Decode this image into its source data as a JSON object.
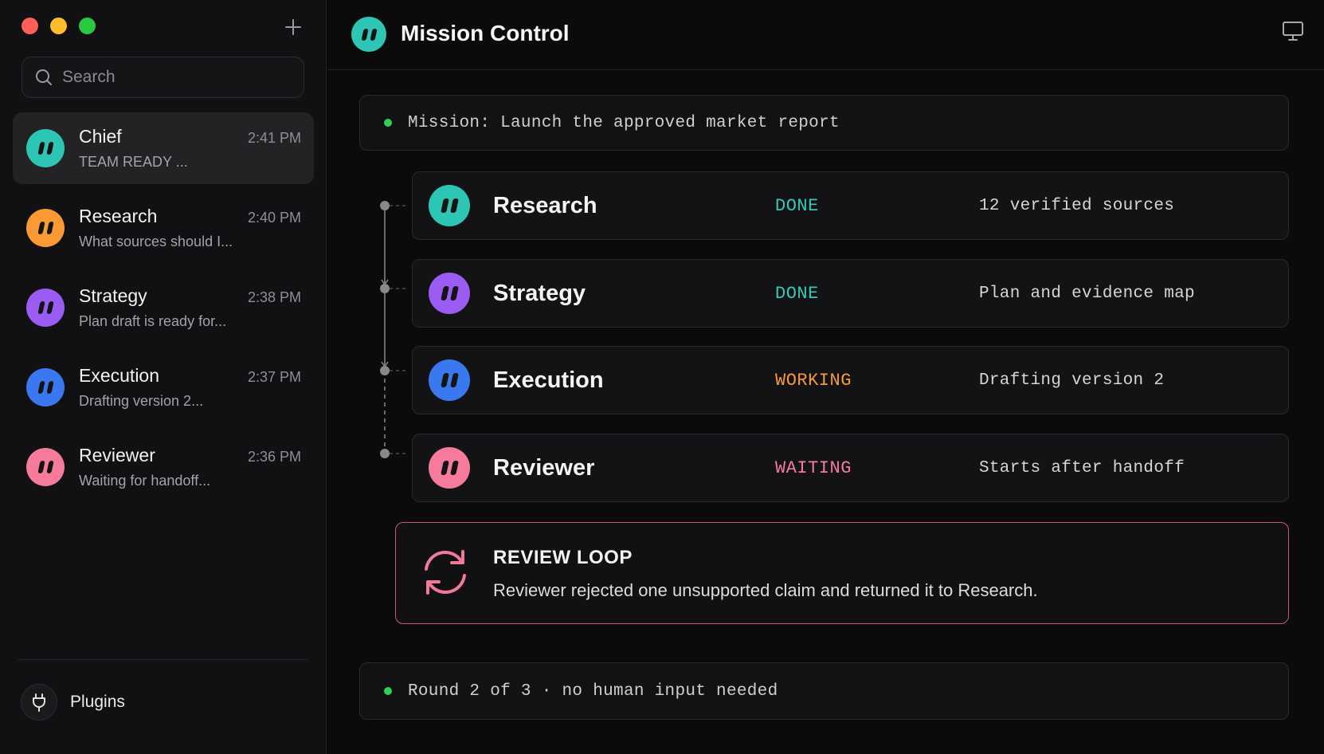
{
  "sidebar": {
    "search": {
      "placeholder": "Search"
    },
    "chats": [
      {
        "name": "Chief",
        "time": "2:41 PM",
        "preview": "TEAM READY ...",
        "color": "#2dc6b4",
        "active": true
      },
      {
        "name": "Research",
        "time": "2:40 PM",
        "preview": "What sources should I...",
        "color": "#f99a35",
        "active": false
      },
      {
        "name": "Strategy",
        "time": "2:38 PM",
        "preview": "Plan draft is ready for...",
        "color": "#9a5cf2",
        "active": false
      },
      {
        "name": "Execution",
        "time": "2:37 PM",
        "preview": "Drafting version 2...",
        "color": "#3a78f0",
        "active": false
      },
      {
        "name": "Reviewer",
        "time": "2:36 PM",
        "preview": "Waiting for handoff...",
        "color": "#f57a9c",
        "active": false
      }
    ],
    "footer": {
      "plugins_label": "Plugins",
      "icon": "plug-icon"
    }
  },
  "header": {
    "title": "Mission Control",
    "avatar_color": "#2dc6b4",
    "right_icon": "display-icon"
  },
  "mission": {
    "text": "Mission: Launch the approved market report",
    "status_color": "#2fd05a"
  },
  "agents": [
    {
      "name": "Research",
      "status": "DONE",
      "detail": "12 verified sources",
      "color": "#2dc6b4",
      "status_color": "#34c8b8"
    },
    {
      "name": "Strategy",
      "status": "DONE",
      "detail": "Plan and evidence map",
      "color": "#9a5cf2",
      "status_color": "#34c8b8"
    },
    {
      "name": "Execution",
      "status": "WORKING",
      "detail": "Drafting version 2",
      "color": "#3a78f0",
      "status_color": "#f59a3c"
    },
    {
      "name": "Reviewer",
      "status": "WAITING",
      "detail": "Starts after handoff",
      "color": "#f57a9c",
      "status_color": "#f57a9c"
    }
  ],
  "review_loop": {
    "title": "REVIEW LOOP",
    "text": "Reviewer rejected one unsupported claim and returned it to Research.",
    "accent": "#f07a98",
    "icon": "refresh-loop-icon"
  },
  "footer_banner": {
    "text": "Round 2 of 3 · no human input needed",
    "status_color": "#2fd05a"
  }
}
